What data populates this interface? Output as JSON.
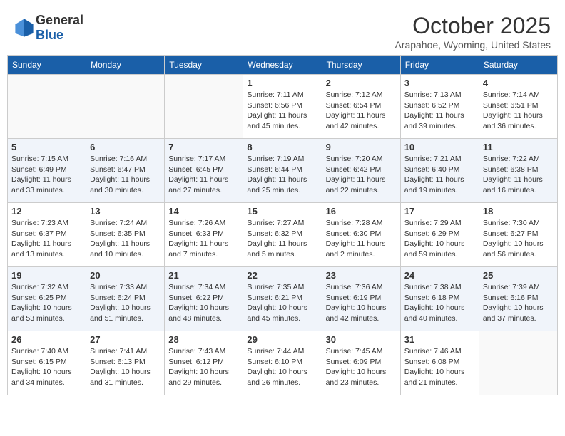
{
  "header": {
    "logo_general": "General",
    "logo_blue": "Blue",
    "month": "October 2025",
    "location": "Arapahoe, Wyoming, United States"
  },
  "days_of_week": [
    "Sunday",
    "Monday",
    "Tuesday",
    "Wednesday",
    "Thursday",
    "Friday",
    "Saturday"
  ],
  "weeks": [
    [
      {
        "day": "",
        "sunrise": "",
        "sunset": "",
        "daylight": ""
      },
      {
        "day": "",
        "sunrise": "",
        "sunset": "",
        "daylight": ""
      },
      {
        "day": "",
        "sunrise": "",
        "sunset": "",
        "daylight": ""
      },
      {
        "day": "1",
        "sunrise": "Sunrise: 7:11 AM",
        "sunset": "Sunset: 6:56 PM",
        "daylight": "Daylight: 11 hours and 45 minutes."
      },
      {
        "day": "2",
        "sunrise": "Sunrise: 7:12 AM",
        "sunset": "Sunset: 6:54 PM",
        "daylight": "Daylight: 11 hours and 42 minutes."
      },
      {
        "day": "3",
        "sunrise": "Sunrise: 7:13 AM",
        "sunset": "Sunset: 6:52 PM",
        "daylight": "Daylight: 11 hours and 39 minutes."
      },
      {
        "day": "4",
        "sunrise": "Sunrise: 7:14 AM",
        "sunset": "Sunset: 6:51 PM",
        "daylight": "Daylight: 11 hours and 36 minutes."
      }
    ],
    [
      {
        "day": "5",
        "sunrise": "Sunrise: 7:15 AM",
        "sunset": "Sunset: 6:49 PM",
        "daylight": "Daylight: 11 hours and 33 minutes."
      },
      {
        "day": "6",
        "sunrise": "Sunrise: 7:16 AM",
        "sunset": "Sunset: 6:47 PM",
        "daylight": "Daylight: 11 hours and 30 minutes."
      },
      {
        "day": "7",
        "sunrise": "Sunrise: 7:17 AM",
        "sunset": "Sunset: 6:45 PM",
        "daylight": "Daylight: 11 hours and 27 minutes."
      },
      {
        "day": "8",
        "sunrise": "Sunrise: 7:19 AM",
        "sunset": "Sunset: 6:44 PM",
        "daylight": "Daylight: 11 hours and 25 minutes."
      },
      {
        "day": "9",
        "sunrise": "Sunrise: 7:20 AM",
        "sunset": "Sunset: 6:42 PM",
        "daylight": "Daylight: 11 hours and 22 minutes."
      },
      {
        "day": "10",
        "sunrise": "Sunrise: 7:21 AM",
        "sunset": "Sunset: 6:40 PM",
        "daylight": "Daylight: 11 hours and 19 minutes."
      },
      {
        "day": "11",
        "sunrise": "Sunrise: 7:22 AM",
        "sunset": "Sunset: 6:38 PM",
        "daylight": "Daylight: 11 hours and 16 minutes."
      }
    ],
    [
      {
        "day": "12",
        "sunrise": "Sunrise: 7:23 AM",
        "sunset": "Sunset: 6:37 PM",
        "daylight": "Daylight: 11 hours and 13 minutes."
      },
      {
        "day": "13",
        "sunrise": "Sunrise: 7:24 AM",
        "sunset": "Sunset: 6:35 PM",
        "daylight": "Daylight: 11 hours and 10 minutes."
      },
      {
        "day": "14",
        "sunrise": "Sunrise: 7:26 AM",
        "sunset": "Sunset: 6:33 PM",
        "daylight": "Daylight: 11 hours and 7 minutes."
      },
      {
        "day": "15",
        "sunrise": "Sunrise: 7:27 AM",
        "sunset": "Sunset: 6:32 PM",
        "daylight": "Daylight: 11 hours and 5 minutes."
      },
      {
        "day": "16",
        "sunrise": "Sunrise: 7:28 AM",
        "sunset": "Sunset: 6:30 PM",
        "daylight": "Daylight: 11 hours and 2 minutes."
      },
      {
        "day": "17",
        "sunrise": "Sunrise: 7:29 AM",
        "sunset": "Sunset: 6:29 PM",
        "daylight": "Daylight: 10 hours and 59 minutes."
      },
      {
        "day": "18",
        "sunrise": "Sunrise: 7:30 AM",
        "sunset": "Sunset: 6:27 PM",
        "daylight": "Daylight: 10 hours and 56 minutes."
      }
    ],
    [
      {
        "day": "19",
        "sunrise": "Sunrise: 7:32 AM",
        "sunset": "Sunset: 6:25 PM",
        "daylight": "Daylight: 10 hours and 53 minutes."
      },
      {
        "day": "20",
        "sunrise": "Sunrise: 7:33 AM",
        "sunset": "Sunset: 6:24 PM",
        "daylight": "Daylight: 10 hours and 51 minutes."
      },
      {
        "day": "21",
        "sunrise": "Sunrise: 7:34 AM",
        "sunset": "Sunset: 6:22 PM",
        "daylight": "Daylight: 10 hours and 48 minutes."
      },
      {
        "day": "22",
        "sunrise": "Sunrise: 7:35 AM",
        "sunset": "Sunset: 6:21 PM",
        "daylight": "Daylight: 10 hours and 45 minutes."
      },
      {
        "day": "23",
        "sunrise": "Sunrise: 7:36 AM",
        "sunset": "Sunset: 6:19 PM",
        "daylight": "Daylight: 10 hours and 42 minutes."
      },
      {
        "day": "24",
        "sunrise": "Sunrise: 7:38 AM",
        "sunset": "Sunset: 6:18 PM",
        "daylight": "Daylight: 10 hours and 40 minutes."
      },
      {
        "day": "25",
        "sunrise": "Sunrise: 7:39 AM",
        "sunset": "Sunset: 6:16 PM",
        "daylight": "Daylight: 10 hours and 37 minutes."
      }
    ],
    [
      {
        "day": "26",
        "sunrise": "Sunrise: 7:40 AM",
        "sunset": "Sunset: 6:15 PM",
        "daylight": "Daylight: 10 hours and 34 minutes."
      },
      {
        "day": "27",
        "sunrise": "Sunrise: 7:41 AM",
        "sunset": "Sunset: 6:13 PM",
        "daylight": "Daylight: 10 hours and 31 minutes."
      },
      {
        "day": "28",
        "sunrise": "Sunrise: 7:43 AM",
        "sunset": "Sunset: 6:12 PM",
        "daylight": "Daylight: 10 hours and 29 minutes."
      },
      {
        "day": "29",
        "sunrise": "Sunrise: 7:44 AM",
        "sunset": "Sunset: 6:10 PM",
        "daylight": "Daylight: 10 hours and 26 minutes."
      },
      {
        "day": "30",
        "sunrise": "Sunrise: 7:45 AM",
        "sunset": "Sunset: 6:09 PM",
        "daylight": "Daylight: 10 hours and 23 minutes."
      },
      {
        "day": "31",
        "sunrise": "Sunrise: 7:46 AM",
        "sunset": "Sunset: 6:08 PM",
        "daylight": "Daylight: 10 hours and 21 minutes."
      },
      {
        "day": "",
        "sunrise": "",
        "sunset": "",
        "daylight": ""
      }
    ]
  ]
}
